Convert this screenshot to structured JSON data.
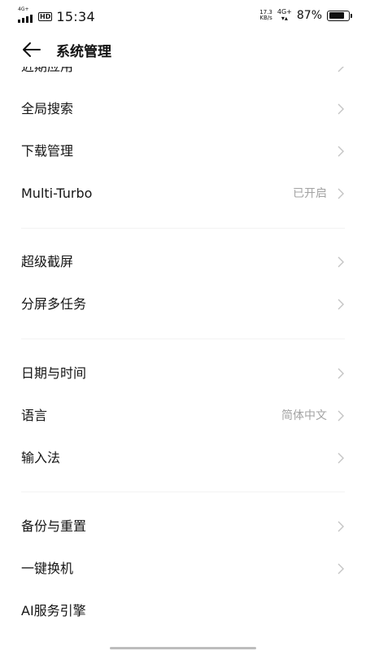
{
  "status_bar": {
    "signal_tag": "4G+",
    "hd_badge": "HD",
    "time": "15:34",
    "net_speed_value": "17.3",
    "net_speed_unit": "KB/s",
    "network": "4G+",
    "battery_percent": "87%",
    "battery_level": 0.87
  },
  "header": {
    "title": "系统管理",
    "back_icon": "arrow-left-icon"
  },
  "list": {
    "partial_item": "近期应用",
    "group1": [
      {
        "label": "全局搜索",
        "value": ""
      },
      {
        "label": "下载管理",
        "value": ""
      },
      {
        "label": "Multi-Turbo",
        "value": "已开启"
      }
    ],
    "group2": [
      {
        "label": "超级截屏",
        "value": ""
      },
      {
        "label": "分屏多任务",
        "value": ""
      }
    ],
    "group3": [
      {
        "label": "日期与时间",
        "value": ""
      },
      {
        "label": "语言",
        "value": "简体中文"
      },
      {
        "label": "输入法",
        "value": ""
      }
    ],
    "group4": [
      {
        "label": "备份与重置",
        "value": ""
      },
      {
        "label": "一键换机",
        "value": ""
      },
      {
        "label": "AI服务引擎",
        "value": ""
      }
    ],
    "chevron_icon": "chevron-right-icon"
  }
}
